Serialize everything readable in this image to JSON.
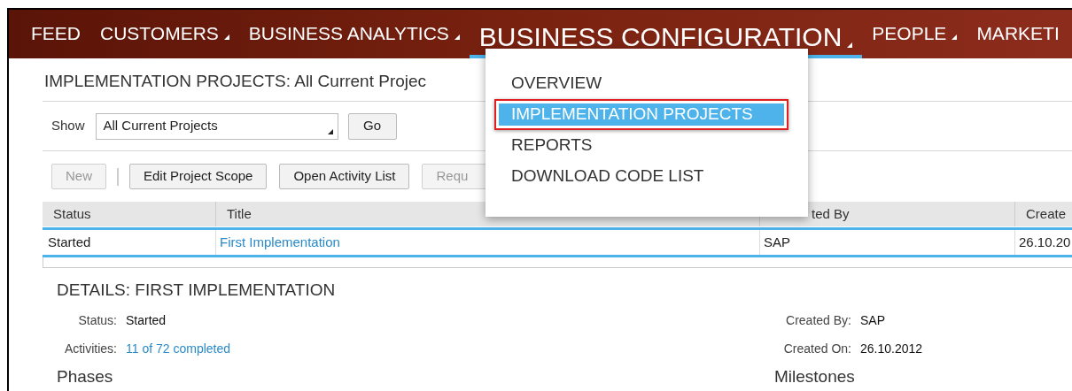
{
  "nav": {
    "items": [
      {
        "label": "FEED",
        "has_menu": false,
        "selected": false
      },
      {
        "label": "CUSTOMERS",
        "has_menu": true,
        "selected": false
      },
      {
        "label": "BUSINESS ANALYTICS",
        "has_menu": true,
        "selected": false
      },
      {
        "label": "BUSINESS CONFIGURATION",
        "has_menu": true,
        "selected": true
      },
      {
        "label": "PEOPLE",
        "has_menu": true,
        "selected": false
      },
      {
        "label": "MARKETI",
        "has_menu": false,
        "selected": false
      }
    ]
  },
  "menu": {
    "items": [
      {
        "label": "OVERVIEW",
        "selected": false,
        "outlined": false
      },
      {
        "label": "IMPLEMENTATION PROJECTS",
        "selected": true,
        "outlined": true
      },
      {
        "label": "REPORTS",
        "selected": false,
        "outlined": false
      },
      {
        "label": "DOWNLOAD CODE LIST",
        "selected": false,
        "outlined": false
      }
    ]
  },
  "page_title": "IMPLEMENTATION PROJECTS: All Current Projec",
  "filter": {
    "label": "Show",
    "value": "All Current Projects",
    "button": "Go"
  },
  "toolbar": {
    "buttons": [
      {
        "label": "New",
        "disabled": true
      },
      {
        "label": "Edit Project Scope",
        "disabled": false
      },
      {
        "label": "Open Activity List",
        "disabled": false
      },
      {
        "label": "Requ",
        "disabled": true
      }
    ]
  },
  "table": {
    "columns": [
      "Status",
      "Title",
      "ted By",
      "Create"
    ],
    "rows": [
      {
        "selected": true,
        "cells": [
          {
            "kind": "text",
            "text": "Started"
          },
          {
            "kind": "link",
            "text": "First Implementation"
          },
          {
            "kind": "text",
            "text": "SAP"
          },
          {
            "kind": "text",
            "text": "26.10.20"
          }
        ]
      }
    ]
  },
  "details": {
    "title": "DETAILS: FIRST IMPLEMENTATION",
    "left_fields": [
      {
        "label": "Status:",
        "value": "Started",
        "kind": "text"
      },
      {
        "label": "Activities:",
        "value": "11 of 72 completed",
        "kind": "link"
      }
    ],
    "right_fields": [
      {
        "label": "Created By:",
        "value": "SAP",
        "kind": "text"
      },
      {
        "label": "Created On:",
        "value": "26.10.2012",
        "kind": "text"
      }
    ],
    "left_section": "Phases",
    "right_section": "Milestones"
  }
}
